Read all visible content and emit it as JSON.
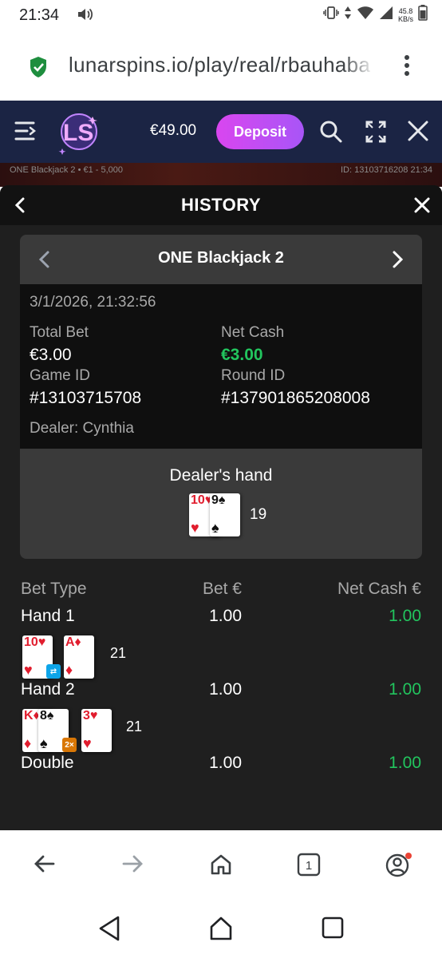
{
  "status": {
    "time": "21:34",
    "net_speed_top": "45.8",
    "net_speed_bottom": "KB/s"
  },
  "browser": {
    "url": "lunarspins.io/play/real/rbauhaba"
  },
  "site": {
    "balance": "€49.00",
    "deposit_label": "Deposit",
    "logo_text": "LS"
  },
  "game_info": {
    "left": "ONE Blackjack 2 • €1 - 5,000",
    "right": "ID: 13103716208 21:34"
  },
  "history": {
    "title": "HISTORY",
    "game_name": "ONE Blackjack 2",
    "datetime": "3/1/2026, 21:32:56",
    "total_bet_label": "Total Bet",
    "total_bet": "€3.00",
    "net_cash_label": "Net Cash",
    "net_cash": "€3.00",
    "game_id_label": "Game ID",
    "game_id": "#13103715708",
    "round_id_label": "Round ID",
    "round_id": "#137901865208008",
    "dealer": "Dealer: Cynthia",
    "dealers_hand_label": "Dealer's hand",
    "dealer_score": "19",
    "dealer_cards": [
      {
        "rank": "10",
        "suit": "♥",
        "color": "#e11d2e"
      },
      {
        "rank": "9",
        "suit": "♠",
        "color": "#111111"
      }
    ]
  },
  "bets": {
    "headers": {
      "type": "Bet Type",
      "bet": "Bet €",
      "net": "Net Cash €"
    },
    "rows": [
      {
        "type": "Hand 1",
        "bet": "1.00",
        "net": "1.00",
        "score": "21",
        "badge": "split",
        "cards": [
          {
            "rank": "10",
            "suit": "♥",
            "color": "#e11d2e"
          },
          {
            "rank": "A",
            "suit": "♦",
            "color": "#e11d2e"
          }
        ]
      },
      {
        "type": "Hand 2",
        "bet": "1.00",
        "net": "1.00",
        "score": "21",
        "badge": "2x",
        "cards": [
          {
            "rank": "K",
            "suit": "♦",
            "color": "#e11d2e"
          },
          {
            "rank": "8",
            "suit": "♠",
            "color": "#111111"
          },
          {
            "rank": "3",
            "suit": "♥",
            "color": "#e11d2e"
          }
        ]
      },
      {
        "type": "Double",
        "bet": "1.00",
        "net": "1.00"
      }
    ]
  },
  "colors": {
    "site_bar": "#1b2444",
    "deposit_gradient_start": "#d946ef",
    "deposit_gradient_end": "#a855f7",
    "win_green": "#22c55e",
    "panel": "#1f1f1f"
  }
}
